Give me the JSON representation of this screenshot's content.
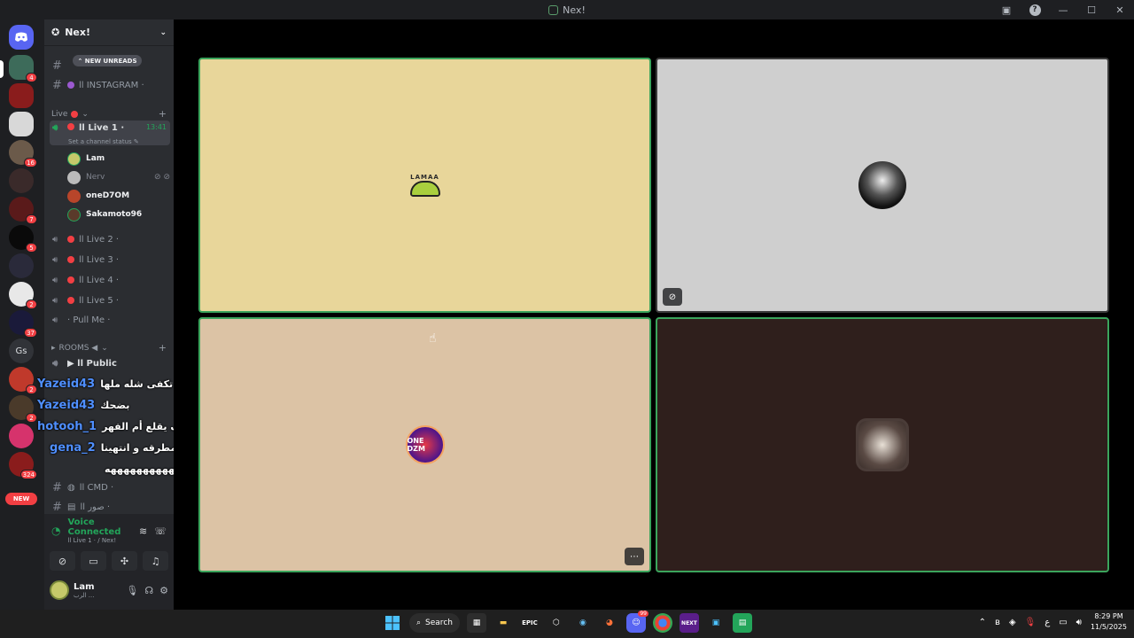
{
  "window": {
    "title": "Nex!",
    "help_label": "?",
    "minimize": "—",
    "maximize": "☐",
    "close": "✕"
  },
  "guild_badges": [
    "4",
    "16",
    "7",
    "5",
    "2",
    "37",
    "2",
    "2",
    "324"
  ],
  "guild_gs_label": "Gs",
  "new_label": "NEW",
  "server": {
    "name": "Nex!",
    "new_unreads": "NEW UNREADS"
  },
  "channels": {
    "top_hidden": "ll INSTAGRAM ·",
    "instagram": "ll INSTAGRAM ·",
    "live_category": "Live",
    "live1": "ll Live 1 ·",
    "live1_time": "13:41",
    "live1_status": "Set a channel status",
    "members": [
      "Lam",
      "Nerv",
      "oneD7OM",
      "Sakamoto96"
    ],
    "live2": "ll Live 2 ·",
    "live3": "ll Live 3 ·",
    "live4": "ll Live 4 ·",
    "live5": "ll Live 5 ·",
    "pullme": "· Pull Me ·",
    "rooms_category": "ROOMS ◀",
    "public": "▶ ll Public",
    "cmd": "ll CMD ·",
    "pics": "ll صور ·"
  },
  "chat_overlay": [
    {
      "user": "Yazeid43",
      "msg": "تكفى شله ملها"
    },
    {
      "user": "Yazeid43",
      "msg": "بضحك"
    },
    {
      "user": "hotooh_1",
      "msg": "طيب ما عندي إلا الف يقلع أم الفهر"
    },
    {
      "user": "gena_2",
      "msg": "يشيل المطرقه و انتهينا"
    },
    {
      "user": "",
      "msg": "ههههههههههههههههههه"
    }
  ],
  "voice": {
    "status": "Voice Connected",
    "channel": "ll Live 1 · / Nex!"
  },
  "user": {
    "name": "Lam",
    "status": "الرب ..."
  },
  "tiles": [
    {
      "label": "LAMAA",
      "bg": "#e8d69a"
    },
    {
      "label": "",
      "bg": "#cfcfcf"
    },
    {
      "label": "ONE DZM",
      "bg": "#dcc3a5"
    },
    {
      "label": "",
      "bg": "#2f1f1c"
    }
  ],
  "taskbar": {
    "search": "Search",
    "epic": "EPIC",
    "next": "NEXT",
    "discord_badge": "99",
    "time": "8:29 PM",
    "date": "11/5/2025",
    "lang": "ع"
  },
  "colors": {
    "accent_green": "#3ba55c",
    "danger": "#f23f43",
    "sidebar": "#2b2d31"
  }
}
